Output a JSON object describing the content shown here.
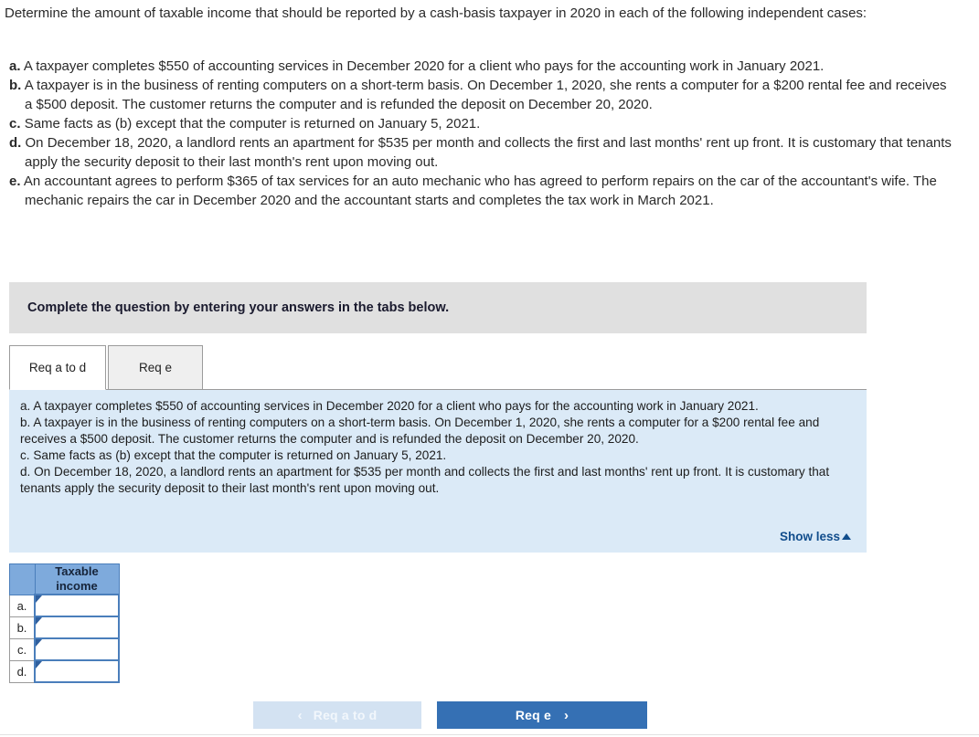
{
  "question": {
    "stem": "Determine the amount of taxable income that should be reported by a cash-basis taxpayer in 2020 in each of the following independent cases:",
    "cases": [
      {
        "letter": "a.",
        "text": "A taxpayer completes $550 of accounting services in December 2020 for a client who pays for the accounting work in January 2021."
      },
      {
        "letter": "b.",
        "text": "A taxpayer is in the business of renting computers on a short-term basis. On December 1, 2020, she rents a computer for a $200 rental fee and receives a $500 deposit. The customer returns the computer and is refunded the deposit on December 20, 2020."
      },
      {
        "letter": "c.",
        "text": "Same facts as (b) except that the computer is returned on January 5, 2021."
      },
      {
        "letter": "d.",
        "text": "On December 18, 2020, a landlord rents an apartment for $535 per month and collects the first and last months' rent up front. It is customary that tenants apply the security deposit to their last month's rent upon moving out."
      },
      {
        "letter": "e.",
        "text": "An accountant agrees to perform $365 of tax services for an auto mechanic who has agreed to perform repairs on the car of the accountant's wife. The mechanic repairs the car in December 2020 and the accountant starts and completes the tax work in March 2021."
      }
    ]
  },
  "instruction_banner": {
    "text": "Complete the question by entering your answers in the tabs below."
  },
  "tabs": [
    {
      "id": "req-a-to-d",
      "label": "Req a to d",
      "active": true
    },
    {
      "id": "req-e",
      "label": "Req e",
      "active": false
    }
  ],
  "requirement_panel": {
    "lines": [
      "a. A taxpayer completes $550 of accounting services in December 2020 for a client who pays for the accounting work in January 2021.",
      "b. A taxpayer is in the business of renting computers on a short-term basis. On December 1, 2020, she rents a computer for a $200 rental fee and receives a $500 deposit. The customer returns the computer and is refunded the deposit on December 20, 2020.",
      "c. Same facts as (b) except that the computer is returned on January 5, 2021.",
      "d. On December 18, 2020, a landlord rents an apartment for $535 per month and collects the first and last months' rent up front. It is customary that tenants apply the security deposit to their last month's rent upon moving out."
    ],
    "show_less_label": "Show less"
  },
  "answer_table": {
    "column_header": "Taxable income",
    "rows": [
      {
        "letter": "a.",
        "value": ""
      },
      {
        "letter": "b.",
        "value": ""
      },
      {
        "letter": "c.",
        "value": ""
      },
      {
        "letter": "d.",
        "value": ""
      }
    ]
  },
  "nav": {
    "prev_label": "Req a to d",
    "prev_chevron": "‹",
    "next_label": "Req e",
    "next_chevron": "›"
  },
  "colors": {
    "banner_grey": "#e0e0e0",
    "panel_blue": "#dbeaf7",
    "table_header_blue": "#7eaadc",
    "table_border_blue": "#4a7ebb",
    "button_active_blue": "#3570b4",
    "button_disabled_blue": "#d3e2f2",
    "link_blue": "#114d8c"
  }
}
